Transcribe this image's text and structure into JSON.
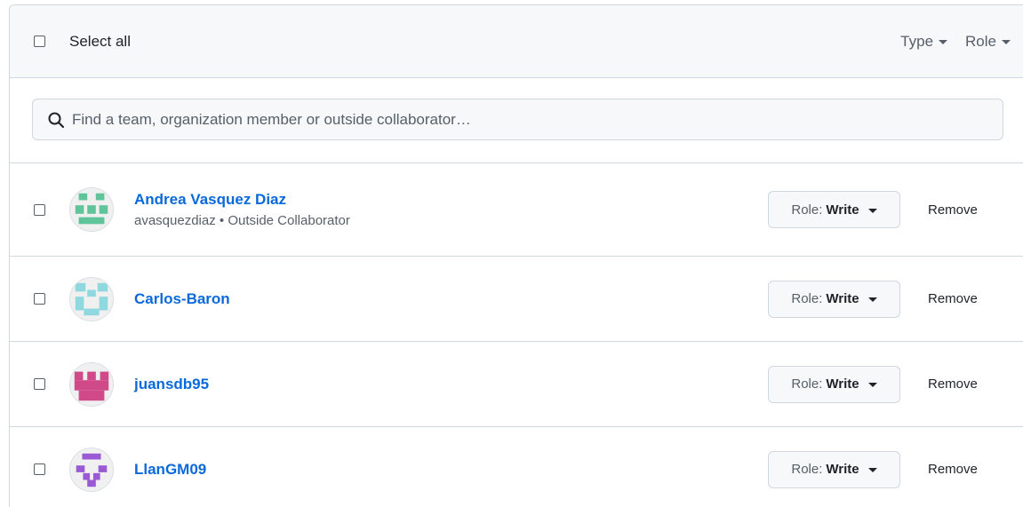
{
  "header": {
    "select_all_label": "Select all",
    "type_filter_label": "Type",
    "role_filter_label": "Role"
  },
  "search": {
    "placeholder": "Find a team, organization member or outside collaborator…"
  },
  "members": [
    {
      "name": "Andrea Vasquez Diaz",
      "subtitle": "avasquezdiaz • Outside Collaborator",
      "role_prefix": "Role:",
      "role": "Write",
      "remove_label": "Remove",
      "avatar_color": "#5fc49a"
    },
    {
      "name": "Carlos-Baron",
      "subtitle": "",
      "role_prefix": "Role:",
      "role": "Write",
      "remove_label": "Remove",
      "avatar_color": "#8fd8e0"
    },
    {
      "name": "juansdb95",
      "subtitle": "",
      "role_prefix": "Role:",
      "role": "Write",
      "remove_label": "Remove",
      "avatar_color": "#d04a8a"
    },
    {
      "name": "LlanGM09",
      "subtitle": "",
      "role_prefix": "Role:",
      "role": "Write",
      "remove_label": "Remove",
      "avatar_color": "#9a5ad6"
    }
  ],
  "colors": {
    "link": "#0969da",
    "border": "#d0d7de",
    "header_bg": "#f6f8fa"
  }
}
